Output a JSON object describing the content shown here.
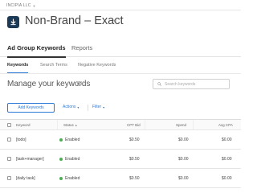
{
  "org": {
    "name": "INCIPIA LLC"
  },
  "campaign": {
    "title": "Non-Brand – Exact"
  },
  "section_tabs": [
    {
      "label": "Ad Group Keywords",
      "active": true
    },
    {
      "label": "Reports",
      "active": false
    }
  ],
  "sub_tabs": [
    {
      "label": "Keywords",
      "active": true
    },
    {
      "label": "Search Terms",
      "active": false
    },
    {
      "label": "Negative Keywords",
      "active": false
    }
  ],
  "manage": {
    "title": "Manage your keywords",
    "help": "?"
  },
  "search": {
    "placeholder": "Search keywords",
    "value": ""
  },
  "toolbar": {
    "add_label": "Add Keywords",
    "actions_label": "Actions",
    "filter_label": "Filter"
  },
  "table": {
    "columns": [
      "Keyword",
      "Status",
      "CPT Bid",
      "Spend",
      "Avg CPA"
    ],
    "rows": [
      {
        "keyword": "[todo]",
        "status": "Enabled",
        "cpt_bid": "$0.50",
        "spend": "$0.00",
        "avg_cpa": "$0.00"
      },
      {
        "keyword": "[task+manager]",
        "status": "Enabled",
        "cpt_bid": "$0.50",
        "spend": "$0.00",
        "avg_cpa": "$0.00"
      },
      {
        "keyword": "[daily task]",
        "status": "Enabled",
        "cpt_bid": "$0.50",
        "spend": "$0.00",
        "avg_cpa": "$0.00"
      }
    ]
  },
  "colors": {
    "accent": "#2b7bd6",
    "enabled": "#4caf50",
    "app_icon": "#1b3a57"
  }
}
